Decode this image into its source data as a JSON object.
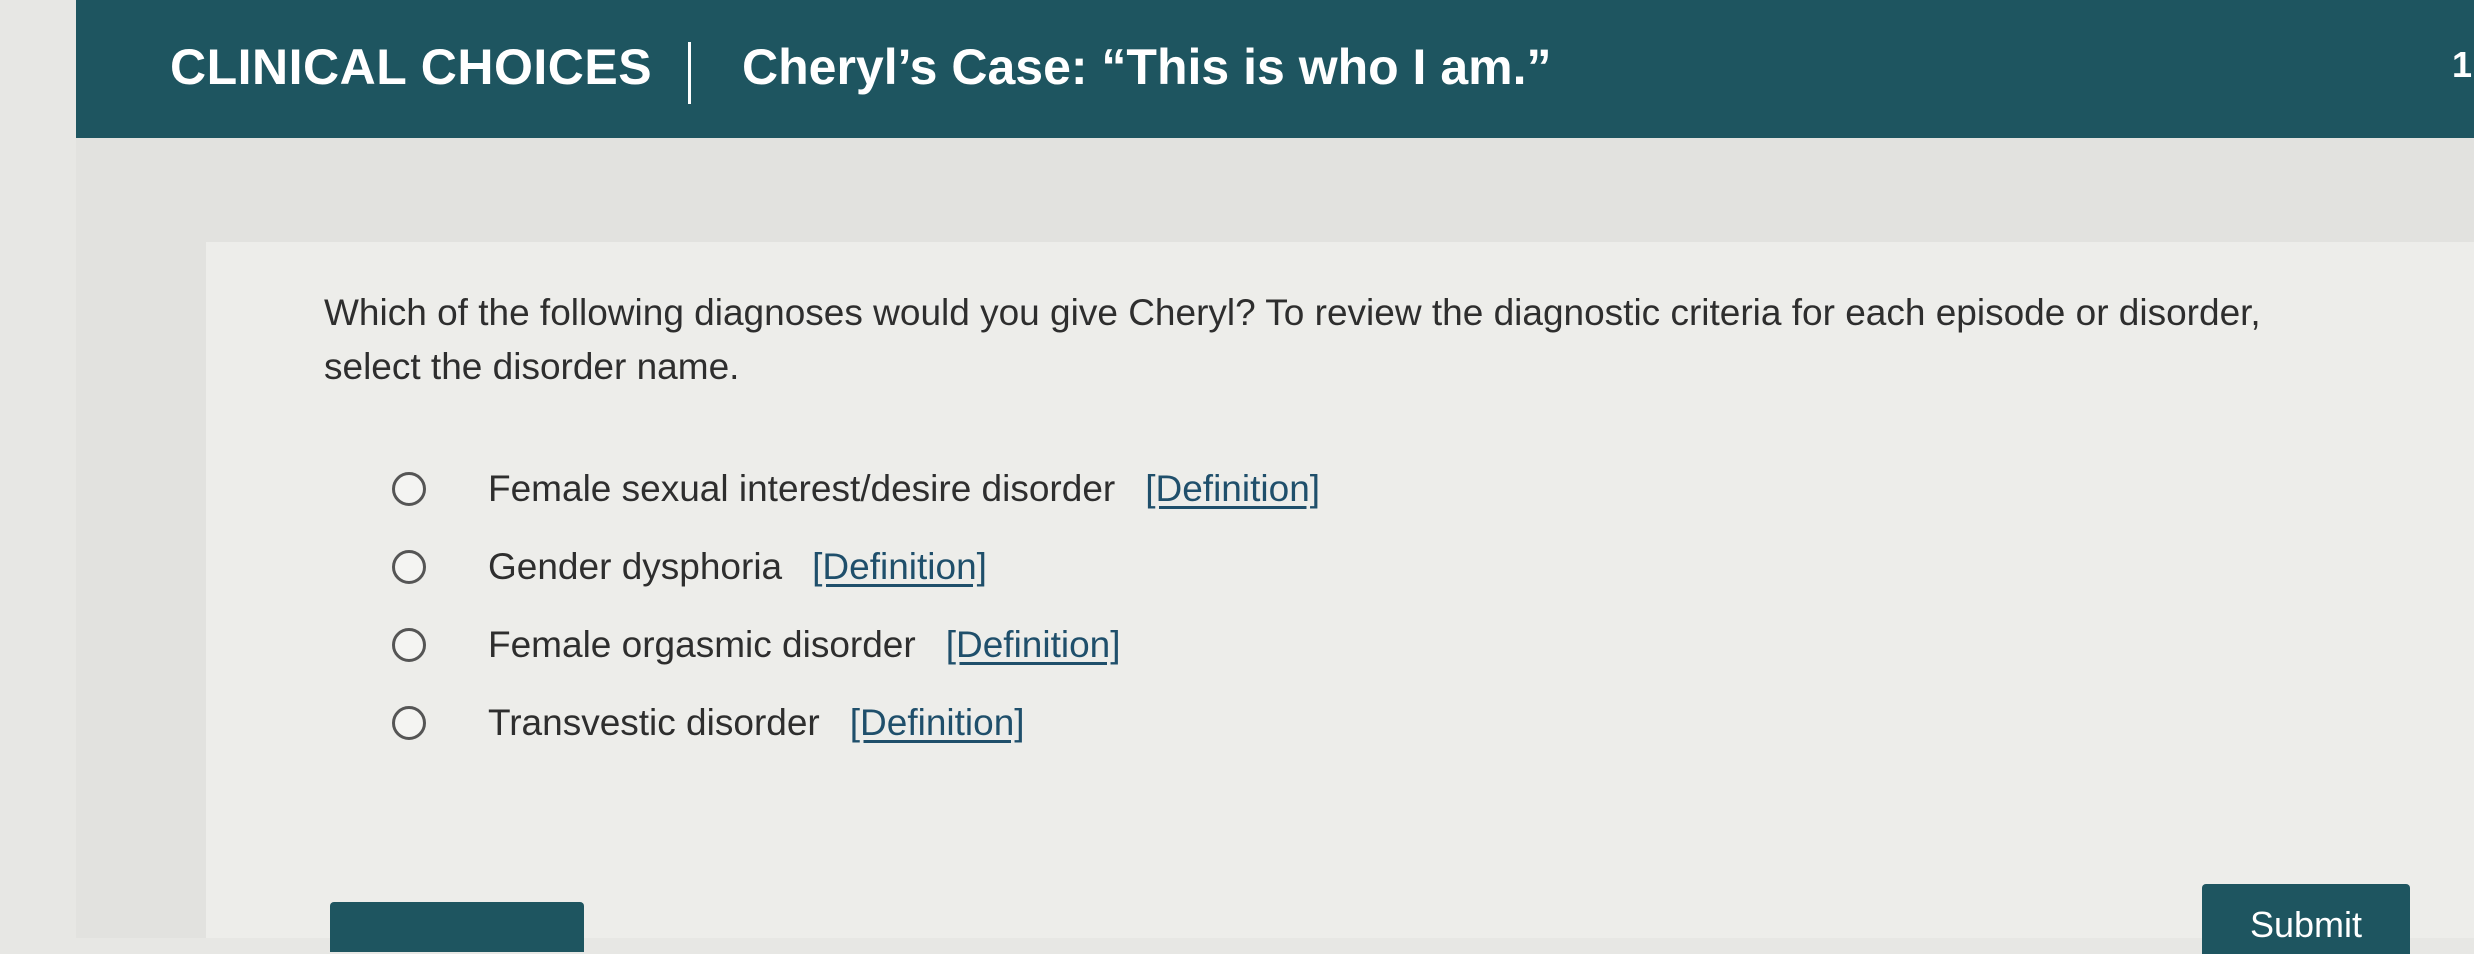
{
  "header": {
    "brand": "CLINICAL CHOICES",
    "case_title": "Cheryl’s Case: “This is who I am.”",
    "page_number": "1"
  },
  "question": {
    "prompt": "Which of the following diagnoses would you give Cheryl? To review the diagnostic criteria for each episode or disorder, select the disorder name."
  },
  "options": [
    {
      "label": "Female sexual interest/desire disorder",
      "link": "[Definition]"
    },
    {
      "label": "Gender dysphoria",
      "link": "[Definition]"
    },
    {
      "label": "Female orgasmic disorder",
      "link": "[Definition]"
    },
    {
      "label": "Transvestic disorder",
      "link": "[Definition]"
    }
  ],
  "buttons": {
    "submit": "Submit"
  },
  "colors": {
    "header_bg": "#1e5560",
    "link": "#1f4f6b",
    "page_bg": "#e7e7e4"
  }
}
